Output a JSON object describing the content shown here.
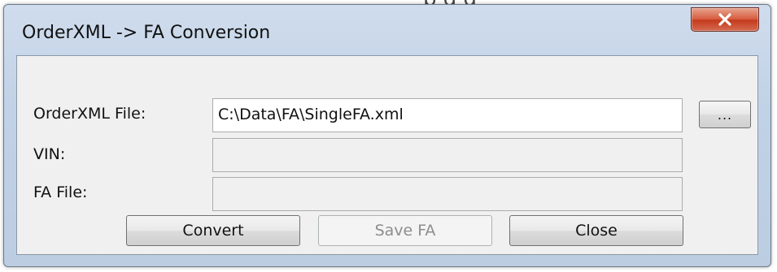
{
  "backdrop": {
    "text": "p         g    g"
  },
  "window": {
    "title": "OrderXML -> FA Conversion",
    "close_glyph": "✕"
  },
  "form": {
    "orderxml": {
      "label": "OrderXML File:",
      "value": "C:\\Data\\FA\\SingleFA.xml"
    },
    "vin": {
      "label": "VIN:",
      "value": ""
    },
    "fafile": {
      "label": "FA File:",
      "value": ""
    },
    "browse_label": "..."
  },
  "buttons": {
    "convert": "Convert",
    "save_fa": "Save FA",
    "close": "Close"
  },
  "colors": {
    "close_red": "#c5391b",
    "window_frame": "#c1d2e6",
    "client_bg": "#f0f0f0"
  }
}
